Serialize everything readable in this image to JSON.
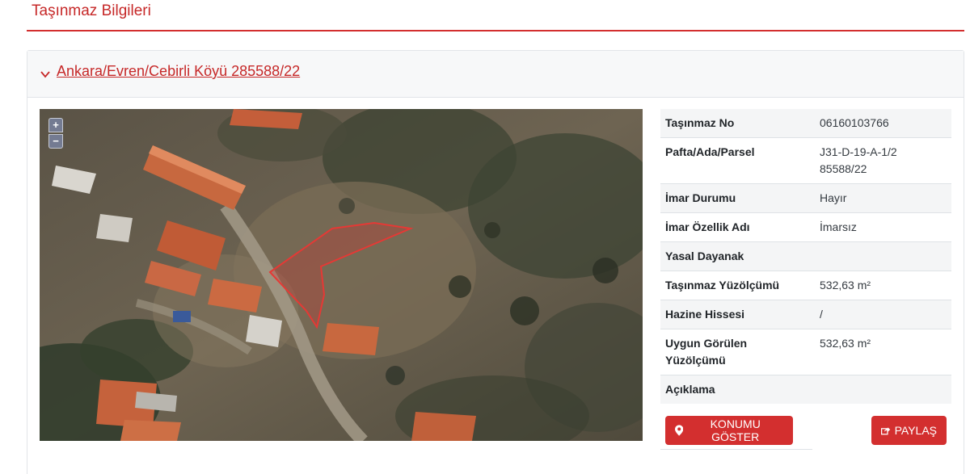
{
  "page": {
    "title": "Taşınmaz Bilgileri"
  },
  "parcel": {
    "link_text": "Ankara/Evren/Cebirli Köyü 285588/22"
  },
  "map": {
    "zoom_in": "+",
    "zoom_out": "−",
    "colors": {
      "parcel_outline": "#d32f2f"
    }
  },
  "details": [
    {
      "label": "Taşınmaz No",
      "value": "06160103766"
    },
    {
      "label": "Pafta/Ada/Parsel",
      "value": "J31-D-19-A-1/285588/22"
    },
    {
      "label": "İmar Durumu",
      "value": "Hayır"
    },
    {
      "label": "İmar Özellik Adı",
      "value": "İmarsız"
    },
    {
      "label": "Yasal Dayanak",
      "value": ""
    },
    {
      "label": "Taşınmaz Yüzölçümü",
      "value": "532,63 m²"
    },
    {
      "label": "Hazine Hissesi",
      "value": "/"
    },
    {
      "label": "Uygun Görülen Yüzölçümü",
      "value": "532,63 m²"
    },
    {
      "label": "Açıklama",
      "value": ""
    }
  ],
  "actions": {
    "show_location": "KONUMU GÖSTER",
    "share": "PAYLAŞ"
  },
  "colors": {
    "accent": "#d32f2f",
    "header_bg": "#f7f8f9"
  }
}
